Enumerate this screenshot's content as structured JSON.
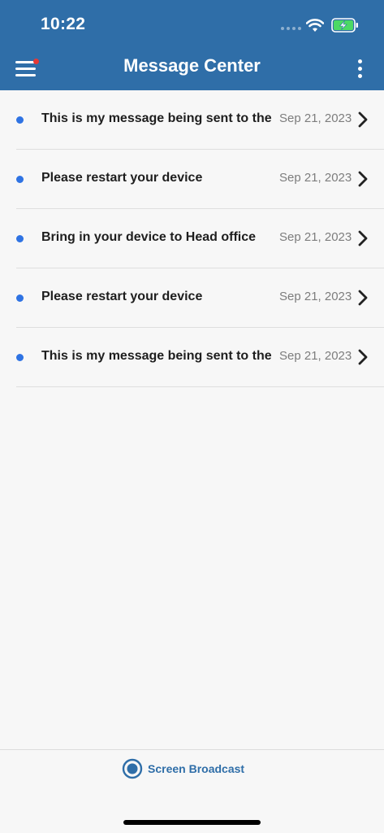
{
  "status_bar": {
    "time": "10:22",
    "icons": [
      "signal-icon",
      "wifi-icon",
      "battery-charging-icon"
    ]
  },
  "nav": {
    "title": "Message Center",
    "menu_icon": "hamburger-menu-icon",
    "menu_badge_color": "#e53935",
    "more_icon": "more-vertical-icon"
  },
  "colors": {
    "header": "#2f6ea8",
    "unread_dot": "#2f73e3",
    "background": "#f7f7f7"
  },
  "messages": [
    {
      "subject": "This is my message being sent to the",
      "date": "Sep 21, 2023",
      "unread": true
    },
    {
      "subject": "Please restart your device",
      "date": "Sep 21, 2023",
      "unread": true
    },
    {
      "subject": "Bring in your device to Head office",
      "date": "Sep 21, 2023",
      "unread": true
    },
    {
      "subject": "Please restart your device",
      "date": "Sep 21, 2023",
      "unread": true
    },
    {
      "subject": "This is my message being sent to the",
      "date": "Sep 21, 2023",
      "unread": true
    }
  ],
  "bottom": {
    "broadcast_label": "Screen Broadcast",
    "broadcast_icon": "record-icon"
  }
}
